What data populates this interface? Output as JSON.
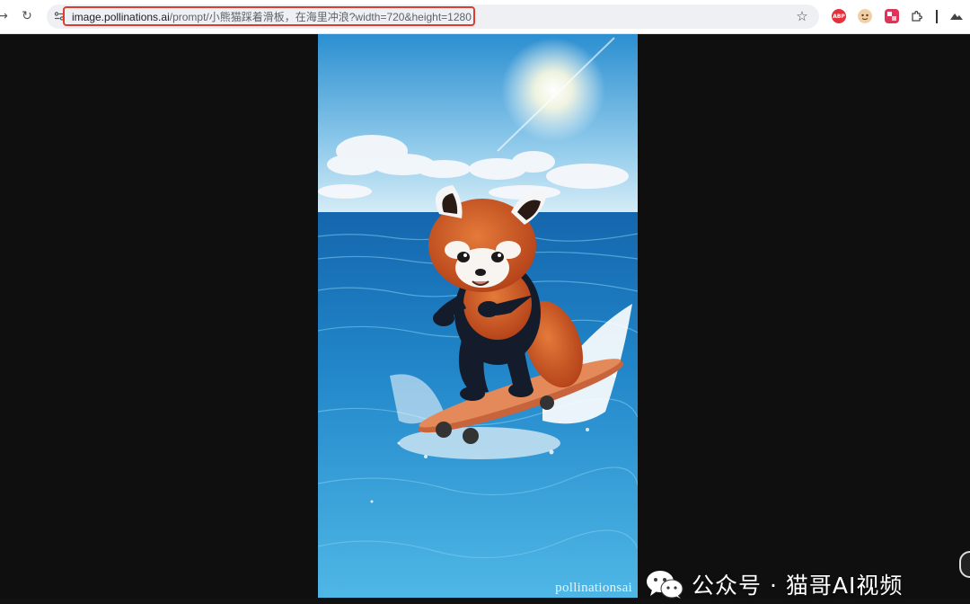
{
  "browser": {
    "url_host": "image.pollinations.ai",
    "url_path": "/prompt/小熊猫踩着滑板，在海里冲浪?width=720&height=1280",
    "back_icon": "→",
    "reload_icon": "↻",
    "star_icon": "☆",
    "extensions": [
      {
        "name": "adblock-plus",
        "label": "ABP"
      },
      {
        "name": "face-extension",
        "label": ""
      },
      {
        "name": "translate-extension",
        "label": ""
      },
      {
        "name": "extensions-puzzle",
        "label": ""
      }
    ],
    "highlight_color": "#e03a2f"
  },
  "content": {
    "image_subject": "red panda on skateboard surfing in the sea",
    "watermark": "pollinationsai",
    "channel_brand": "公众号 · 猫哥AI视频"
  },
  "colors": {
    "page_bg": "#111111",
    "sky_top": "#3a9fd8",
    "sea": "#1d7ec4",
    "panda_orange": "#c9541f"
  }
}
